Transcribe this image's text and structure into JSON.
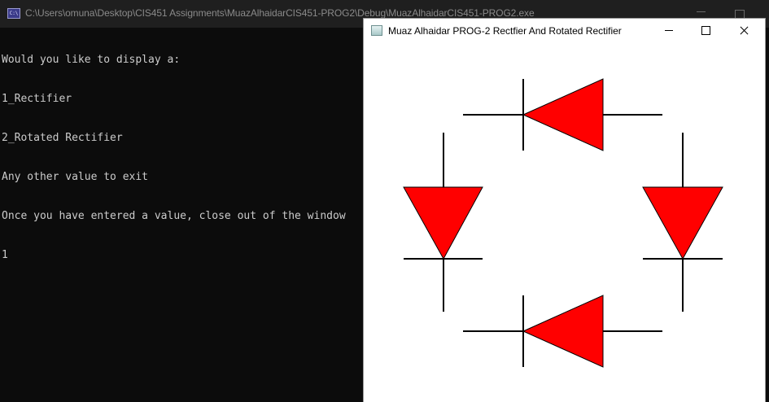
{
  "console": {
    "title": "C:\\Users\\omuna\\Desktop\\CIS451 Assignments\\MuazAlhaidarCIS451-PROG2\\Debug\\MuazAlhaidarCIS451-PROG2.exe",
    "icon": "console-app-icon",
    "icon_label": "C:\\",
    "lines": [
      "Would you like to display a:",
      "1_Rectifier",
      "2_Rotated Rectifier",
      "Any other value to exit",
      "Once you have entered a value, close out of the window",
      "1"
    ]
  },
  "plot_window": {
    "title": "Muaz Alhaidar PROG-2 Rectfier And Rotated Rectifier",
    "icon": "graphics-window-icon",
    "fill_color": "#ff0000",
    "line_color": "#000000",
    "background": "#ffffff",
    "diodes": [
      {
        "name": "diode-top",
        "orientation": "left"
      },
      {
        "name": "diode-left",
        "orientation": "down"
      },
      {
        "name": "diode-right",
        "orientation": "down"
      },
      {
        "name": "diode-bottom",
        "orientation": "left"
      }
    ]
  }
}
